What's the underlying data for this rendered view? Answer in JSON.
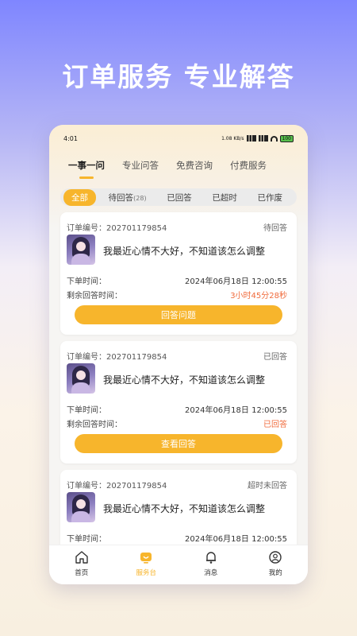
{
  "headline": "订单服务 专业解答",
  "status_bar": {
    "time": "4:01",
    "speed": "1.08 KB/s",
    "battery": "100"
  },
  "tabs": [
    {
      "label": "一事一问",
      "active": true
    },
    {
      "label": "专业问答",
      "active": false
    },
    {
      "label": "免费咨询",
      "active": false
    },
    {
      "label": "付费服务",
      "active": false
    }
  ],
  "filters": [
    {
      "label": "全部",
      "active": true
    },
    {
      "label": "待回答",
      "count": "(28)",
      "active": false
    },
    {
      "label": "已回答",
      "active": false
    },
    {
      "label": "已超时",
      "active": false
    },
    {
      "label": "已作废",
      "active": false
    }
  ],
  "cards": [
    {
      "order_label": "订单编号：202701179854",
      "status": "待回答",
      "question": "我最近心情不大好，不知道该怎么调整",
      "time_label": "下单时间：",
      "time_value": "2024年06月18日 12:00:55",
      "remain_label": "剩余回答时间：",
      "remain_value": "3小时45分28秒",
      "button": "回答问题"
    },
    {
      "order_label": "订单编号：202701179854",
      "status": "已回答",
      "question": "我最近心情不大好，不知道该怎么调整",
      "time_label": "下单时间：",
      "time_value": "2024年06月18日 12:00:55",
      "remain_label": "剩余回答时间：",
      "remain_value": "已回答",
      "button": "查看回答"
    },
    {
      "order_label": "订单编号：202701179854",
      "status": "超时未回答",
      "question": "我最近心情不大好，不知道该怎么调整",
      "time_label": "下单时间：",
      "time_value": "2024年06月18日 12:00:55"
    }
  ],
  "nav": [
    {
      "label": "首页",
      "icon": "home-icon",
      "active": false
    },
    {
      "label": "服务台",
      "icon": "service-desk-icon",
      "active": true
    },
    {
      "label": "消息",
      "icon": "bell-icon",
      "active": false
    },
    {
      "label": "我的",
      "icon": "profile-icon",
      "active": false
    }
  ],
  "colors": {
    "accent": "#f7b52c",
    "countdown": "#f06b3c"
  }
}
